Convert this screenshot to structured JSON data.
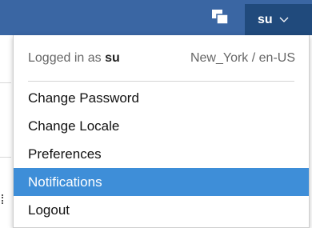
{
  "header": {
    "user_label": "su",
    "windows_icon": "stacked-windows-icon",
    "chevron_icon": "chevron-down-icon"
  },
  "dropdown": {
    "logged_in_prefix": "Logged in as ",
    "username": "su",
    "locale": "New_York / en-US",
    "items": [
      {
        "label": "Change Password",
        "active": false
      },
      {
        "label": "Change Locale",
        "active": false
      },
      {
        "label": "Preferences",
        "active": false
      },
      {
        "label": "Notifications",
        "active": true
      },
      {
        "label": "Logout",
        "active": false
      }
    ]
  },
  "colors": {
    "topbar": "#3a66a3",
    "user_button": "#204a7c",
    "highlight": "#3e8ed8"
  }
}
